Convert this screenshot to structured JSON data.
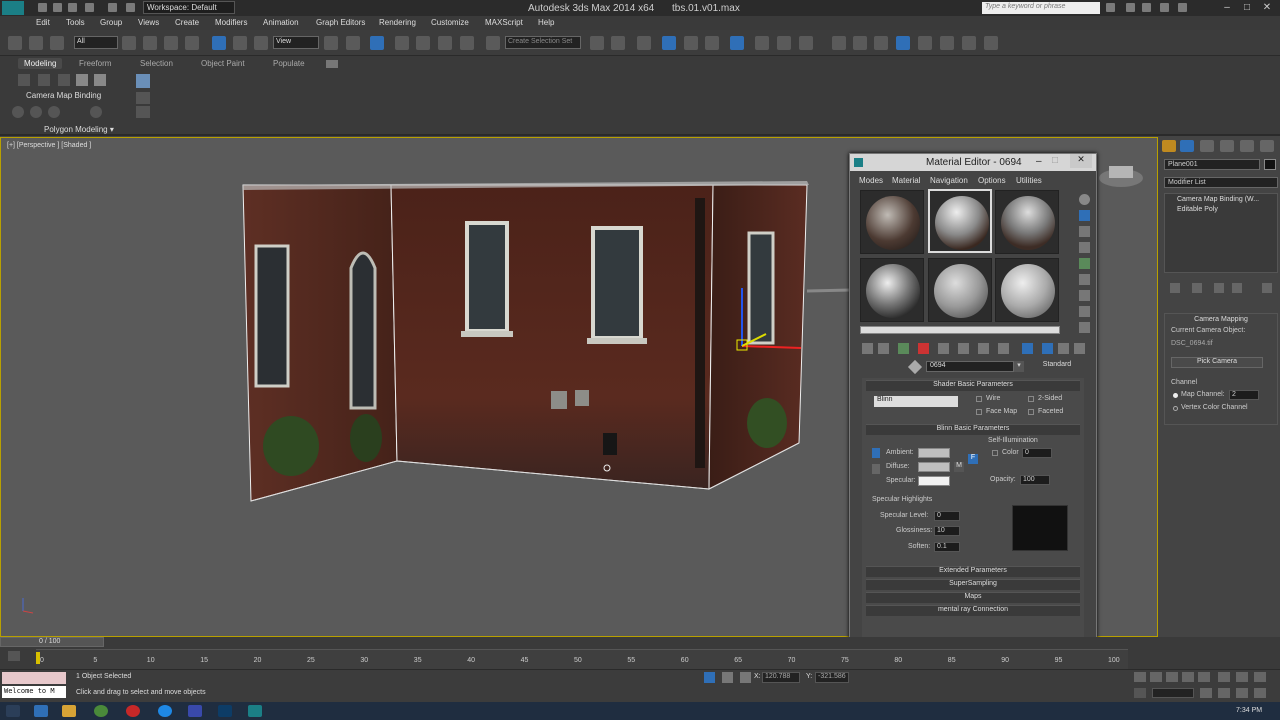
{
  "titlebar": {
    "workspace": "Workspace: Default",
    "app_title": "Autodesk 3ds Max  2014 x64",
    "file_name": "tbs.01.v01.max",
    "search_placeholder": "Type a keyword or phrase"
  },
  "menu": [
    "Edit",
    "Tools",
    "Group",
    "Views",
    "Create",
    "Modifiers",
    "Animation",
    "Graph Editors",
    "Rendering",
    "Customize",
    "MAXScript",
    "Help"
  ],
  "toolbar": {
    "selection_filter": "All",
    "reference_coord": "View",
    "named_selection": "Create Selection Set"
  },
  "ribbon": {
    "tabs": [
      "Modeling",
      "Freeform",
      "Selection",
      "Object Paint",
      "Populate"
    ],
    "active_tab": "Modeling",
    "panel_item": "Camera Map Binding",
    "footer": "Polygon Modeling ▾"
  },
  "viewport": {
    "label": "[+] [Perspective ] [Shaded ]"
  },
  "material_editor": {
    "title": "Material Editor - 0694",
    "menu": [
      "Modes",
      "Material",
      "Navigation",
      "Options",
      "Utilities"
    ],
    "material_name": "0694",
    "material_type": "Standard",
    "shader_header": "Shader Basic Parameters",
    "shader": "Blinn",
    "wire": "Wire",
    "two_sided": "2-Sided",
    "face_map": "Face Map",
    "faceted": "Faceted",
    "blinn_header": "Blinn Basic Parameters",
    "self_illum": "Self-Illumination",
    "color_label": "Color",
    "color_value": "0",
    "ambient": "Ambient:",
    "diffuse": "Diffuse:",
    "specular": "Specular:",
    "diffuse_map_btn": "M",
    "lock_btn": "F",
    "opacity_label": "Opacity:",
    "opacity_value": "100",
    "spec_highlights": "Specular Highlights",
    "spec_level_label": "Specular Level:",
    "spec_level": "0",
    "glossiness_label": "Glossiness:",
    "glossiness": "10",
    "soften_label": "Soften:",
    "soften": "0.1",
    "rollouts": [
      "Extended Parameters",
      "SuperSampling",
      "Maps",
      "mental ray Connection"
    ]
  },
  "command_panel": {
    "object_name": "Plane001",
    "modifier_list": "Modifier List",
    "stack": [
      "Camera Map Binding (W...",
      "Editable Poly"
    ],
    "cam_mapping_header": "Camera Mapping",
    "current_camera_label": "Current Camera Object:",
    "current_camera": "DSC_0694.tif",
    "pick_camera": "Pick Camera",
    "channel_label": "Channel",
    "map_channel": "Map Channel:",
    "map_channel_value": "2",
    "vertex_color": "Vertex Color Channel"
  },
  "timeline": {
    "frame": "0 / 100",
    "ticks": [
      "0",
      "5",
      "10",
      "15",
      "20",
      "25",
      "30",
      "35",
      "40",
      "45",
      "50",
      "55",
      "60",
      "65",
      "70",
      "75",
      "80",
      "85",
      "90",
      "95",
      "100"
    ]
  },
  "status": {
    "maxscript": "Welcome to M",
    "selected": "1 Object Selected",
    "prompt": "Click and drag to select and move objects",
    "x": "120.788",
    "y": "-321.586"
  },
  "taskbar": {
    "time": "7:34 PM"
  }
}
